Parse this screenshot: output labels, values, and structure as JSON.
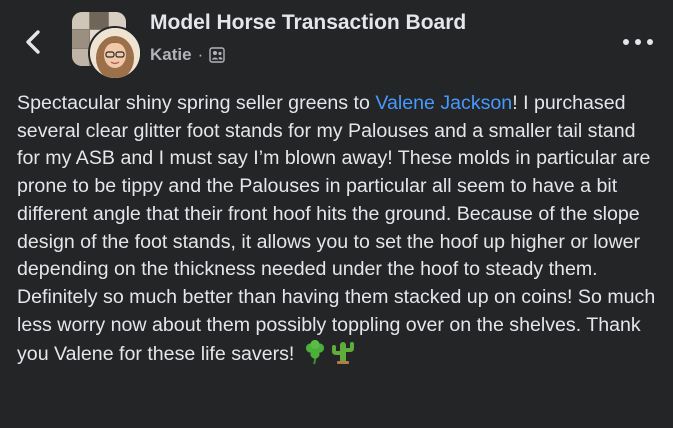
{
  "header": {
    "group_name": "Model Horse Transaction Board",
    "author": "Katie",
    "separator": "·",
    "back_icon": "chevron-left-icon",
    "more_icon": "more-horizontal-icon",
    "privacy_icon": "group-members-icon"
  },
  "post": {
    "text_before_mention": "Spectacular shiny spring seller greens to ",
    "mention": "Valene Jackson",
    "text_after_mention": "! I purchased several clear glitter foot stands for my Palouses and a smaller tail stand for my ASB and I must say I’m blown away! These molds in particular are prone to be tippy and the Palouses in particular all seem to have a bit different angle that their front hoof hits the ground. Because of the slope design of the foot stands, it allows you to set the hoof up higher or lower depending on the thickness needed under the hoof to steady them. Definitely so much better than having them stacked up on coins! So much less worry now about them possibly toppling over on the shelves. Thank you Valene for these life savers!",
    "emojis": [
      "shamrock-emoji",
      "cactus-emoji"
    ]
  },
  "colors": {
    "background": "#242526",
    "text": "#e4e6eb",
    "secondary_text": "#b0b3b8",
    "mention": "#4599ff"
  }
}
